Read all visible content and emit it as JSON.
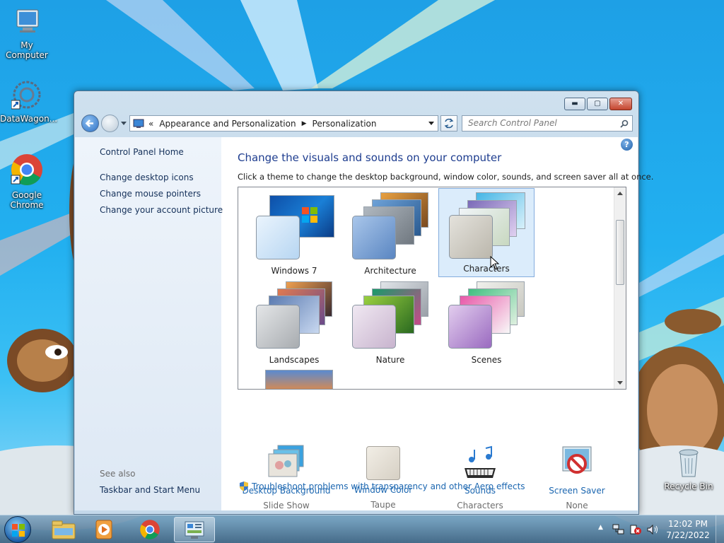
{
  "desktop": {
    "icons": [
      {
        "label": "My Computer",
        "icon": "computer-icon"
      },
      {
        "label": "DataWagon...",
        "icon": "datawagon-icon"
      },
      {
        "label": "Google Chrome",
        "icon": "chrome-icon"
      },
      {
        "label": "Recycle Bin",
        "icon": "recycle-bin-icon"
      }
    ]
  },
  "window": {
    "controls": {
      "minimize": "minimize-icon",
      "maximize": "maximize-icon",
      "close": "close-icon"
    },
    "address": {
      "chevron": "«",
      "crumbs": [
        "Appearance and Personalization",
        "Personalization"
      ]
    },
    "search_placeholder": "Search Control Panel",
    "sidebar": {
      "home": "Control Panel Home",
      "links": [
        "Change desktop icons",
        "Change mouse pointers",
        "Change your account picture"
      ],
      "see_also": "See also",
      "see_also_links": [
        "Taskbar and Start Menu"
      ]
    },
    "main": {
      "heading": "Change the visuals and sounds on your computer",
      "subtitle": "Click a theme to change the desktop background, window color, sounds, and screen saver all at once.",
      "themes": [
        {
          "name": "Windows 7",
          "selected": false
        },
        {
          "name": "Architecture",
          "selected": false
        },
        {
          "name": "Characters",
          "selected": true
        },
        {
          "name": "Landscapes",
          "selected": false
        },
        {
          "name": "Nature",
          "selected": false
        },
        {
          "name": "Scenes",
          "selected": false
        }
      ],
      "settings": [
        {
          "title": "Desktop Background",
          "value": "Slide Show",
          "icon": "desktop-background-icon"
        },
        {
          "title": "Window Color",
          "value": "Taupe",
          "icon": "window-color-icon"
        },
        {
          "title": "Sounds",
          "value": "Characters",
          "icon": "sounds-icon"
        },
        {
          "title": "Screen Saver",
          "value": "None",
          "icon": "screen-saver-icon"
        }
      ],
      "troubleshoot": "Troubleshoot problems with transparency and other Aero effects"
    }
  },
  "taskbar": {
    "items": [
      "start-orb-icon",
      "explorer-icon",
      "media-player-icon",
      "chrome-icon",
      "control-panel-icon"
    ],
    "time": "12:02 PM",
    "date": "7/22/2022"
  },
  "colors": {
    "accent": "#1e3d8f",
    "link": "#1b66b0",
    "selection": "#dbecfb"
  }
}
